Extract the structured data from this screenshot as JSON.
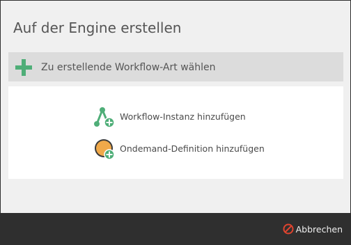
{
  "dialog": {
    "title": "Auf der Engine erstellen"
  },
  "section": {
    "icon": "plus-icon",
    "label": "Zu erstellende Workflow-Art wählen"
  },
  "options": [
    {
      "icon": "workflow-instance-add-icon",
      "label": "Workflow-Instanz hinzufügen"
    },
    {
      "icon": "ondemand-definition-add-icon",
      "label": "Ondemand-Definition hinzufügen"
    }
  ],
  "footer": {
    "cancel_icon": "cancel-icon",
    "cancel_label": "Abbrechen"
  },
  "colors": {
    "accent_green": "#4fae78",
    "orange": "#f0a94a",
    "cancel_red": "#e0442f",
    "footer_bg": "#2f2f2f"
  }
}
